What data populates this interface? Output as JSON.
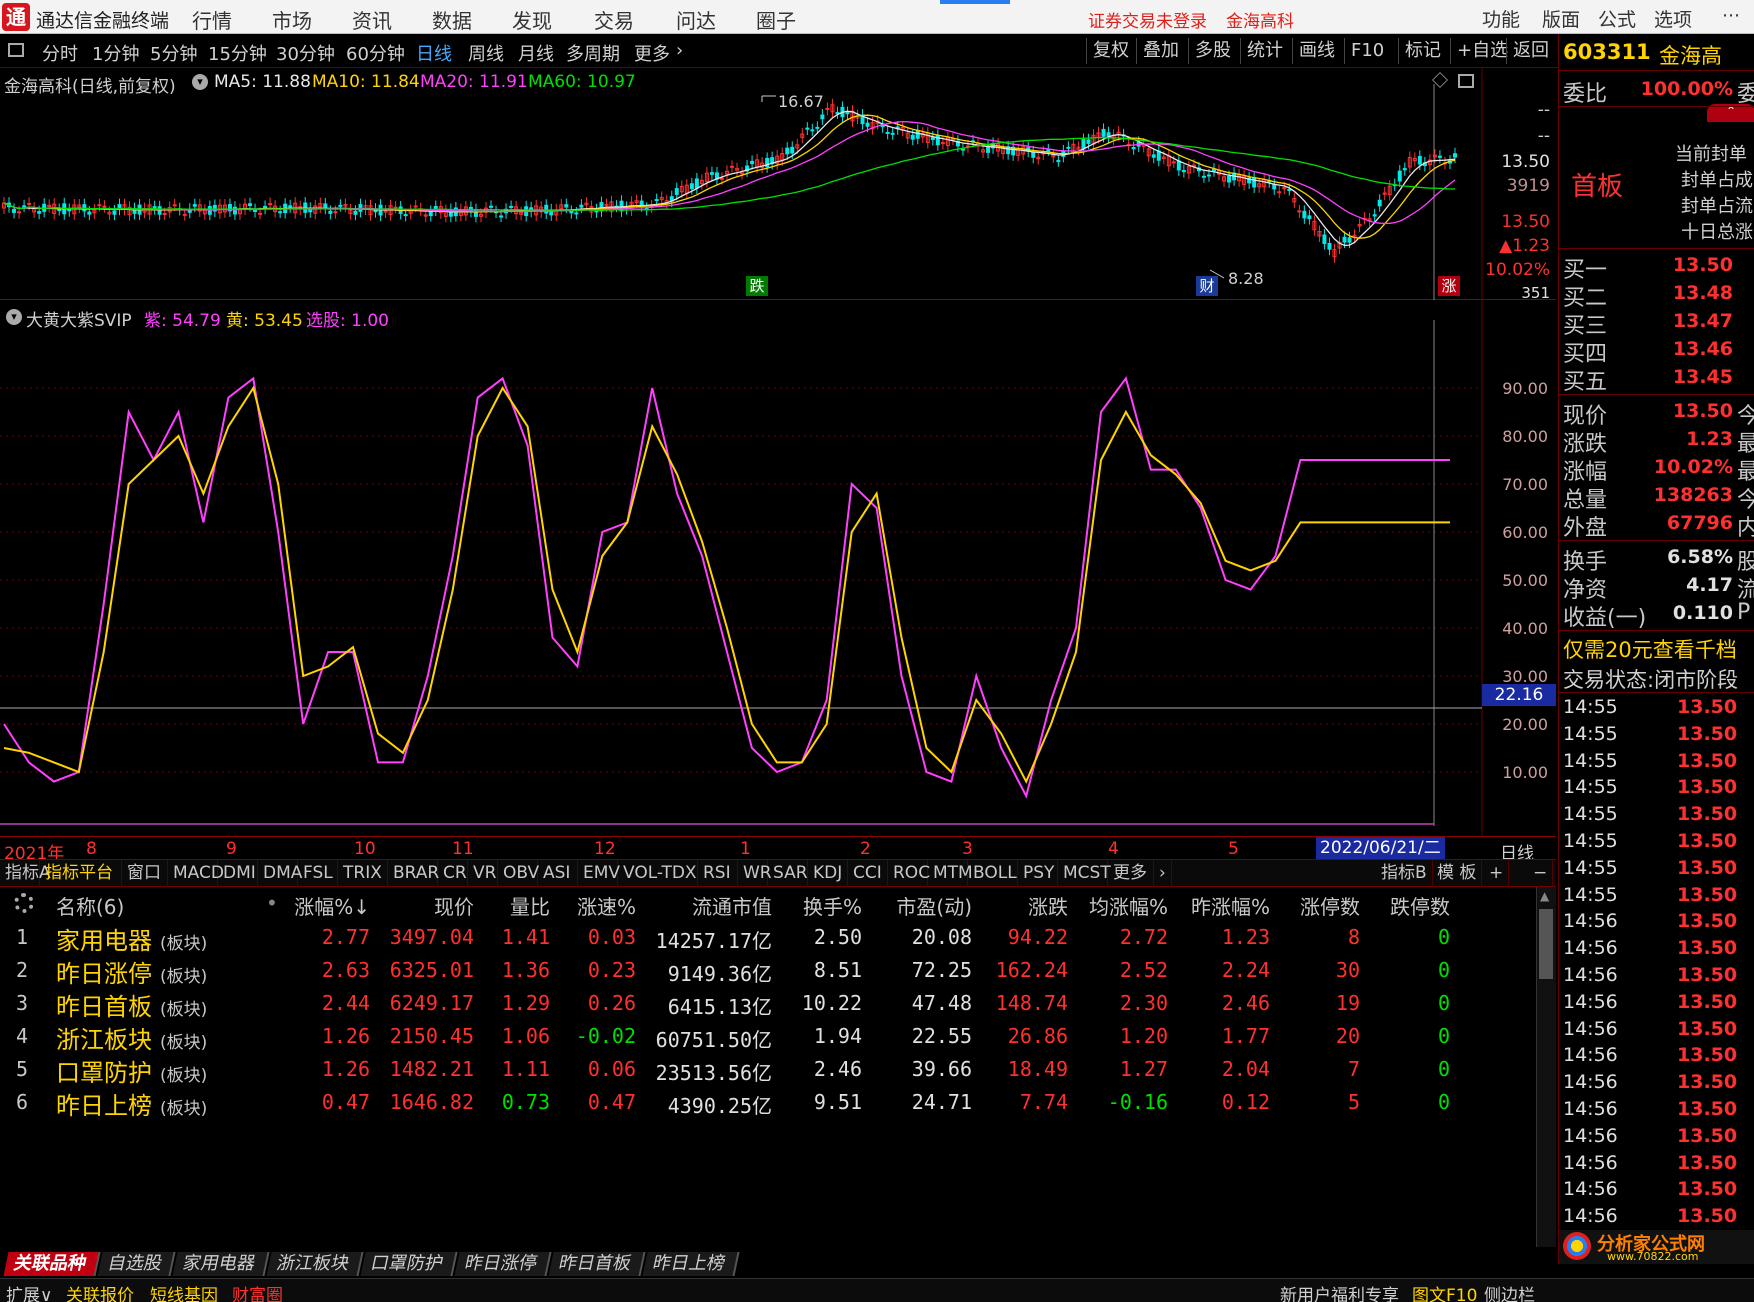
{
  "app": {
    "logo": "通",
    "title": "通达信金融终端",
    "menu": [
      "行情",
      "市场",
      "资讯",
      "数据",
      "发现",
      "交易",
      "问达",
      "圈子"
    ],
    "warning": "证券交易未登录",
    "stock_name": "金海高科",
    "right_menu": [
      "功能",
      "版面",
      "公式",
      "选项"
    ]
  },
  "toolbar": {
    "periods": [
      "分时",
      "1分钟",
      "5分钟",
      "15分钟",
      "30分钟",
      "60分钟",
      "日线",
      "周线",
      "月线",
      "多周期",
      "更多"
    ],
    "active_period": "日线",
    "tools": [
      "复权",
      "叠加",
      "多股",
      "统计",
      "画线",
      "F10",
      "标记",
      "+自选",
      "返回"
    ]
  },
  "main_chart": {
    "caption": "金海高科(日线,前复权)",
    "ma": [
      {
        "label": "MA5: 11.88",
        "color": "#e8e8e8"
      },
      {
        "label": "MA10: 11.84",
        "color": "#ffd400"
      },
      {
        "label": "MA20: 11.91",
        "color": "#ff40ff"
      },
      {
        "label": "MA60: 10.97",
        "color": "#00e000"
      }
    ],
    "high_label": "16.67",
    "low_label": "8.28",
    "marker_down": "跌",
    "marker_cai": "财",
    "marker_up": "涨",
    "axis": [
      "--",
      "--",
      "13.50",
      "3919",
      "13.50",
      "▲1.23",
      "10.02%",
      "351"
    ]
  },
  "indicator": {
    "caption": "大黄大紫SVIP",
    "values": [
      {
        "label": "紫: 54.79",
        "color": "#ff40ff"
      },
      {
        "label": "黄: 53.45",
        "color": "#ffd400"
      },
      {
        "label": "选股: 1.00",
        "color": "#ff40ff"
      }
    ],
    "axis": [
      "90.00",
      "80.00",
      "70.00",
      "60.00",
      "50.00",
      "40.00",
      "30.00",
      "20.00",
      "10.00"
    ],
    "crosshair_value": "22.16"
  },
  "chart_data": {
    "type": "line",
    "title": "大黄大紫SVIP",
    "x": [
      0,
      5,
      10,
      15,
      20,
      25,
      30,
      35,
      40,
      45,
      50,
      55,
      60,
      65,
      70,
      75,
      80,
      85,
      90,
      95,
      100,
      105,
      110,
      115,
      120,
      125,
      130,
      135,
      140,
      145,
      150,
      155,
      160,
      165,
      170,
      175,
      180,
      185,
      190,
      195,
      200,
      205,
      210,
      215,
      220,
      225,
      230,
      235,
      240,
      245,
      250,
      255,
      260,
      265,
      270,
      275,
      280,
      285,
      290
    ],
    "series": [
      {
        "name": "紫",
        "color": "#ff40ff",
        "values": [
          20,
          12,
          8,
          10,
          45,
          85,
          75,
          85,
          62,
          88,
          92,
          60,
          20,
          35,
          35,
          12,
          12,
          30,
          55,
          88,
          92,
          78,
          38,
          32,
          60,
          62,
          90,
          68,
          55,
          35,
          15,
          10,
          12,
          25,
          70,
          65,
          30,
          10,
          8,
          30,
          15,
          5,
          25,
          40,
          85,
          92,
          73,
          73,
          65,
          50,
          48,
          55,
          75,
          75,
          75,
          75,
          75,
          75,
          75
        ]
      },
      {
        "name": "黄",
        "color": "#ffd400",
        "values": [
          15,
          14,
          12,
          10,
          35,
          70,
          75,
          80,
          68,
          82,
          90,
          70,
          30,
          32,
          36,
          18,
          14,
          25,
          48,
          80,
          90,
          82,
          48,
          35,
          55,
          62,
          82,
          72,
          58,
          40,
          20,
          12,
          12,
          20,
          60,
          68,
          38,
          15,
          10,
          25,
          18,
          8,
          20,
          35,
          75,
          85,
          76,
          72,
          66,
          54,
          52,
          54,
          62,
          62,
          62,
          62,
          62,
          62,
          62
        ]
      }
    ],
    "ylim": [
      0,
      100
    ],
    "ticks": [
      90,
      80,
      70,
      60,
      50,
      40,
      30,
      20,
      10
    ]
  },
  "time_axis": {
    "year": "2021年",
    "months": [
      "8",
      "9",
      "10",
      "11",
      "12",
      "1",
      "2",
      "3",
      "4",
      "5"
    ],
    "cursor_date": "2022/06/21/二",
    "period": "日线"
  },
  "indicator_tabs": [
    "指标A",
    "指标平台",
    "窗口",
    "MACD",
    "DMI",
    "DMA",
    "FSL",
    "TRIX",
    "BRAR",
    "CR",
    "VR",
    "OBV",
    "ASI",
    "EMV",
    "VOL-TDX",
    "RSI",
    "WR",
    "SAR",
    "KDJ",
    "CCI",
    "ROC",
    "MTM",
    "BOLL",
    "PSY",
    "MCST",
    "更多"
  ],
  "indicator_tabs_right": [
    "指标B",
    "模 板",
    "+",
    "−"
  ],
  "table": {
    "name_header": "名称(6)",
    "headers": [
      "涨幅%↓",
      "现价",
      "量比",
      "涨速%",
      "流通市值",
      "换手%",
      "市盈(动)",
      "涨跌",
      "均涨幅%",
      "昨涨幅%",
      "涨停数",
      "跌停数"
    ],
    "sector_tag": "(板块)",
    "rows": [
      {
        "idx": "1",
        "name": "家用电器",
        "cells": [
          "2.77",
          "3497.04",
          "1.41",
          "0.03",
          "14257.17亿",
          "2.50",
          "20.08",
          "94.22",
          "2.72",
          "1.23",
          "8",
          "0"
        ],
        "colors": [
          "red",
          "red",
          "red",
          "red",
          "white",
          "white",
          "white",
          "red",
          "red",
          "red",
          "red",
          "green"
        ]
      },
      {
        "idx": "2",
        "name": "昨日涨停",
        "cells": [
          "2.63",
          "6325.01",
          "1.36",
          "0.23",
          "9149.36亿",
          "8.51",
          "72.25",
          "162.24",
          "2.52",
          "2.24",
          "30",
          "0"
        ],
        "colors": [
          "red",
          "red",
          "red",
          "red",
          "white",
          "white",
          "white",
          "red",
          "red",
          "red",
          "red",
          "green"
        ]
      },
      {
        "idx": "3",
        "name": "昨日首板",
        "cells": [
          "2.44",
          "6249.17",
          "1.29",
          "0.26",
          "6415.13亿",
          "10.22",
          "47.48",
          "148.74",
          "2.30",
          "2.46",
          "19",
          "0"
        ],
        "colors": [
          "red",
          "red",
          "red",
          "red",
          "white",
          "white",
          "white",
          "red",
          "red",
          "red",
          "red",
          "green"
        ]
      },
      {
        "idx": "4",
        "name": "浙江板块",
        "cells": [
          "1.26",
          "2150.45",
          "1.06",
          "-0.02",
          "60751.50亿",
          "1.94",
          "22.55",
          "26.86",
          "1.20",
          "1.77",
          "20",
          "0"
        ],
        "colors": [
          "red",
          "red",
          "red",
          "green",
          "white",
          "white",
          "white",
          "red",
          "red",
          "red",
          "red",
          "green"
        ]
      },
      {
        "idx": "5",
        "name": "口罩防护",
        "cells": [
          "1.26",
          "1482.21",
          "1.11",
          "0.06",
          "23513.56亿",
          "2.46",
          "39.66",
          "18.49",
          "1.27",
          "2.04",
          "7",
          "0"
        ],
        "colors": [
          "red",
          "red",
          "red",
          "red",
          "white",
          "white",
          "white",
          "red",
          "red",
          "red",
          "red",
          "green"
        ]
      },
      {
        "idx": "6",
        "name": "昨日上榜",
        "cells": [
          "0.47",
          "1646.82",
          "0.73",
          "0.47",
          "4390.25亿",
          "9.51",
          "24.71",
          "7.74",
          "-0.16",
          "0.12",
          "5",
          "0"
        ],
        "colors": [
          "red",
          "red",
          "green",
          "red",
          "white",
          "white",
          "white",
          "red",
          "green",
          "red",
          "red",
          "green"
        ]
      }
    ]
  },
  "bottom_tabs": [
    "关联品种",
    "自选股",
    "家用电器",
    "浙江板块",
    "口罩防护",
    "昨日涨停",
    "昨日首板",
    "昨日上榜"
  ],
  "status_bar": {
    "left": [
      {
        "text": "扩展∨",
        "color": "#d0d0d0"
      },
      {
        "text": "关联报价",
        "color": "#ffd400"
      },
      {
        "text": "短线基因",
        "color": "#ffd400"
      },
      {
        "text": "财富圈",
        "color": "#ff3030"
      }
    ],
    "right": [
      {
        "text": "新用户福利专享",
        "color": "#d0d0d0"
      },
      {
        "text": "图文F10",
        "color": "#ffd400"
      },
      {
        "text": "侧边栏",
        "color": "#d0d0d0"
      }
    ]
  },
  "right_panel": {
    "code": "603311",
    "name": "金海高",
    "weibi_label": "委比",
    "weibi_value": "100.00%",
    "weibi_suffix": "委",
    "shouban": "首板",
    "notes": [
      "当前封单",
      "封单占成",
      "封单占流",
      "十日总涨"
    ],
    "bids": [
      {
        "label": "买一",
        "value": "13.50"
      },
      {
        "label": "买二",
        "value": "13.48"
      },
      {
        "label": "买三",
        "value": "13.47"
      },
      {
        "label": "买四",
        "value": "13.46"
      },
      {
        "label": "买五",
        "value": "13.45"
      }
    ],
    "stats": [
      {
        "label": "现价",
        "value": "13.50",
        "suffix": "今"
      },
      {
        "label": "涨跌",
        "value": "1.23",
        "suffix": "最"
      },
      {
        "label": "涨幅",
        "value": "10.02%",
        "suffix": "最"
      },
      {
        "label": "总量",
        "value": "138263",
        "suffix": "今"
      },
      {
        "label": "外盘",
        "value": "67796",
        "suffix": "内"
      }
    ],
    "stats2": [
      {
        "label": "换手",
        "value": "6.58%",
        "suffix": "股"
      },
      {
        "label": "净资",
        "value": "4.17",
        "suffix": "流"
      },
      {
        "label": "收益(一)",
        "value": "0.110",
        "suffix": "P"
      }
    ],
    "promo": "仅需20元查看千档",
    "trade_status": "交易状态:闭市阶段",
    "ticks": [
      {
        "t": "14:55",
        "p": "13.50"
      },
      {
        "t": "14:55",
        "p": "13.50"
      },
      {
        "t": "14:55",
        "p": "13.50"
      },
      {
        "t": "14:55",
        "p": "13.50"
      },
      {
        "t": "14:55",
        "p": "13.50"
      },
      {
        "t": "14:55",
        "p": "13.50"
      },
      {
        "t": "14:55",
        "p": "13.50"
      },
      {
        "t": "14:55",
        "p": "13.50"
      },
      {
        "t": "14:56",
        "p": "13.50"
      },
      {
        "t": "14:56",
        "p": "13.50"
      },
      {
        "t": "14:56",
        "p": "13.50"
      },
      {
        "t": "14:56",
        "p": "13.50"
      },
      {
        "t": "14:56",
        "p": "13.50"
      },
      {
        "t": "14:56",
        "p": "13.50"
      },
      {
        "t": "14:56",
        "p": "13.50"
      },
      {
        "t": "14:56",
        "p": "13.50"
      },
      {
        "t": "14:56",
        "p": "13.50"
      },
      {
        "t": "14:56",
        "p": "13.50"
      },
      {
        "t": "14:56",
        "p": "13.50"
      },
      {
        "t": "14:56",
        "p": "13.50"
      }
    ],
    "watermark": "分析家公式网",
    "watermark_url": "www.70822.com"
  }
}
